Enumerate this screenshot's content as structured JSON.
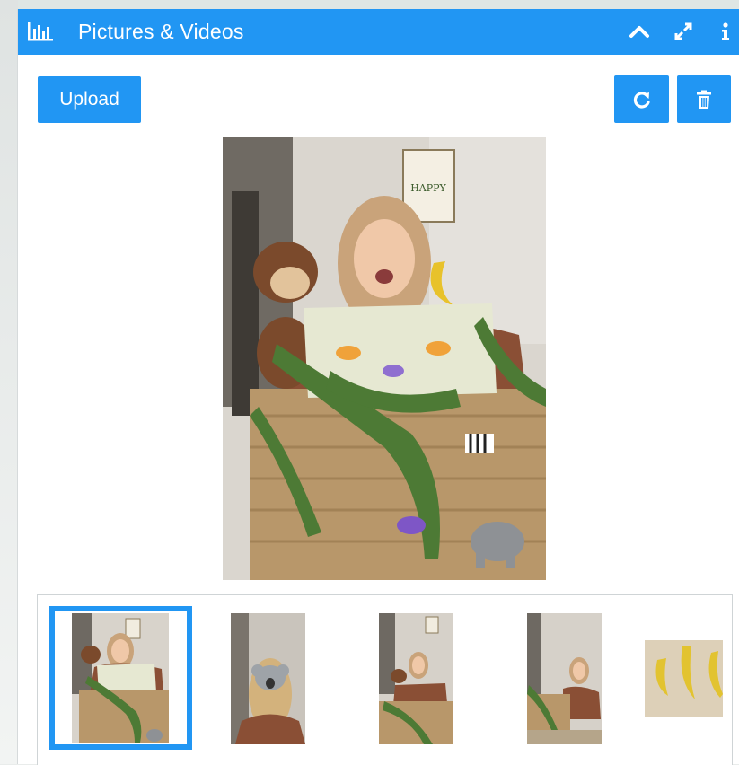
{
  "header": {
    "title": "Pictures & Videos",
    "icons": [
      "bar-chart-icon",
      "chevron-up-icon",
      "expand-icon",
      "info-icon"
    ]
  },
  "toolbar": {
    "upload_label": "Upload",
    "refresh_icon": "refresh-icon",
    "delete_icon": "trash-icon"
  },
  "main_image": {
    "poster_text": "HAPPY"
  },
  "thumbnails": [
    {
      "name": "thumbnail-jungle-basket",
      "selected": true
    },
    {
      "name": "thumbnail-koala-mask",
      "selected": false
    },
    {
      "name": "thumbnail-jungle-wide",
      "selected": false
    },
    {
      "name": "thumbnail-jungle-side",
      "selected": false
    },
    {
      "name": "thumbnail-bananas",
      "selected": false
    }
  ],
  "colors": {
    "accent": "#2196f3",
    "panel_bg": "#ffffff",
    "page_bg": "#e9eceb"
  }
}
